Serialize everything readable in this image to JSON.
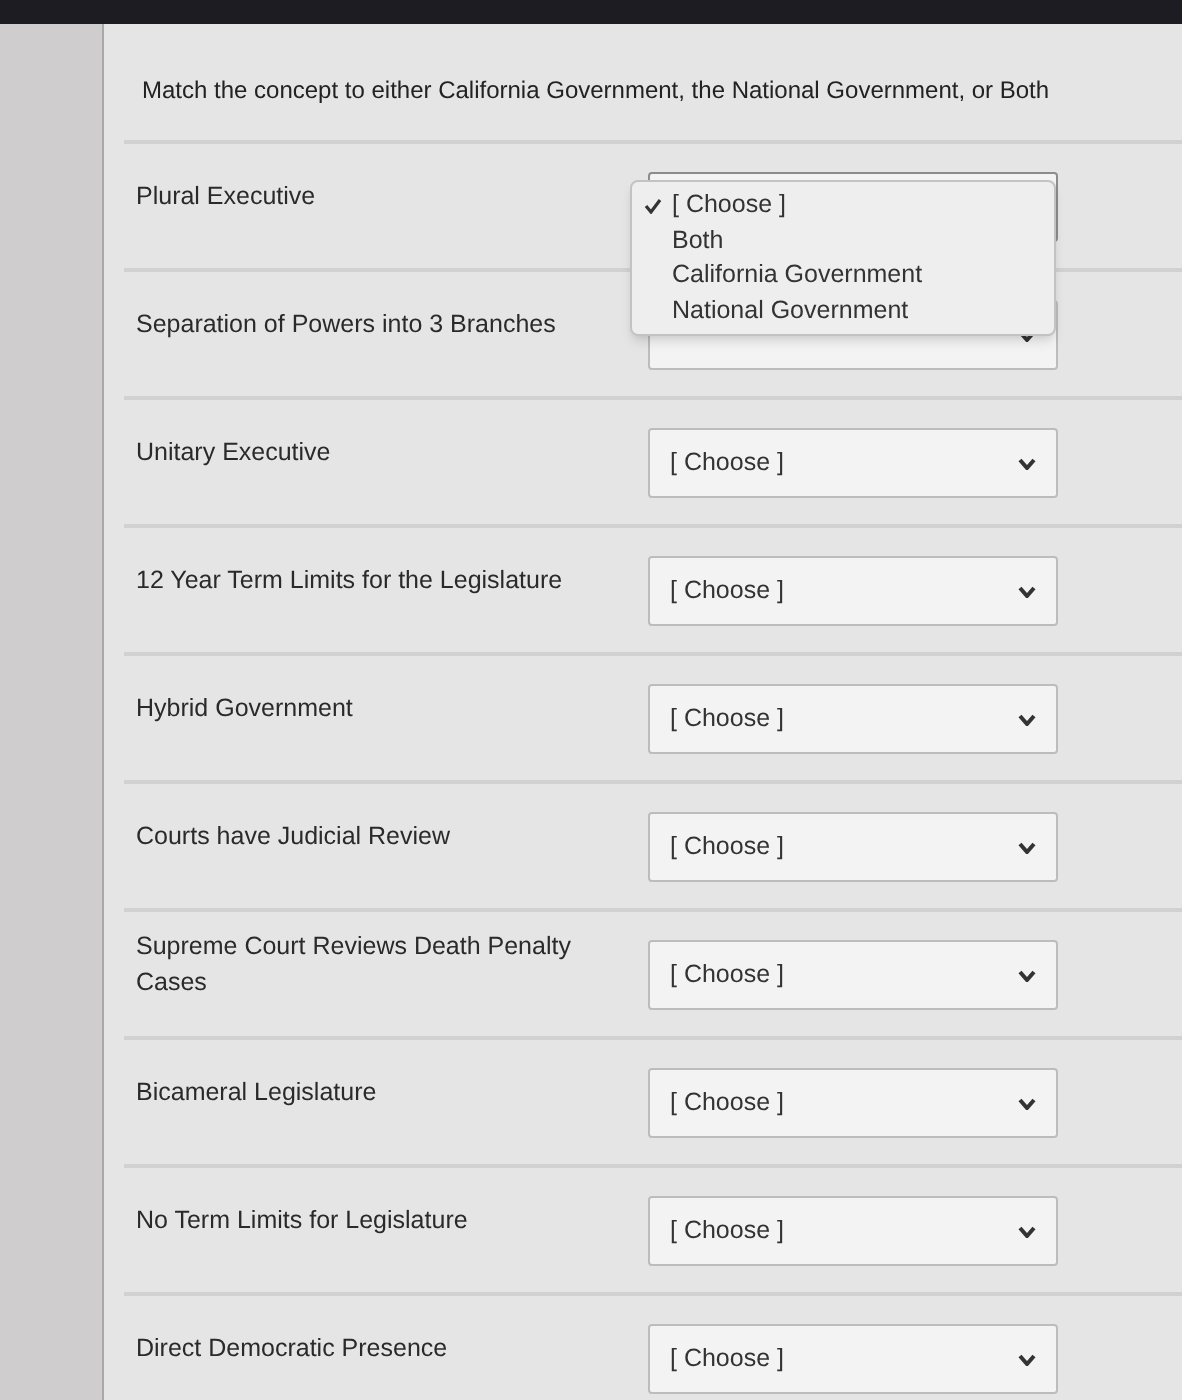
{
  "instructions": "Match the concept to either California Government, the National Government, or Both",
  "rows": [
    {
      "concept": "Plural Executive",
      "open": true
    },
    {
      "concept": "Separation of Powers into 3 Branches",
      "open": false
    },
    {
      "concept": "Unitary Executive",
      "value": "[ Choose ]",
      "open": false
    },
    {
      "concept": "12 Year Term Limits for the Legislature",
      "value": "[ Choose ]",
      "open": false
    },
    {
      "concept": "Hybrid Government",
      "value": "[ Choose ]",
      "open": false
    },
    {
      "concept": "Courts have Judicial Review",
      "value": "[ Choose ]",
      "open": false
    },
    {
      "concept": "Supreme Court Reviews Death Penalty Cases",
      "value": "[ Choose ]",
      "open": false
    },
    {
      "concept": "Bicameral Legislature",
      "value": "[ Choose ]",
      "open": false
    },
    {
      "concept": "No Term Limits for Legislature",
      "value": "[ Choose ]",
      "open": false
    },
    {
      "concept": "Direct Democratic Presence",
      "value": "[ Choose ]",
      "open": false
    }
  ],
  "menu": {
    "options": [
      {
        "label": "[ Choose ]",
        "selected": true
      },
      {
        "label": "Both",
        "selected": false
      },
      {
        "label": "California Government",
        "selected": false
      },
      {
        "label": "National Government",
        "selected": false
      }
    ]
  }
}
